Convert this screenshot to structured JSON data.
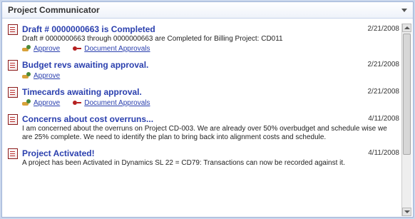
{
  "window": {
    "title": "Project Communicator"
  },
  "items": [
    {
      "title": "Draft # 0000000663 is Completed",
      "date": "2/21/2008",
      "description": "Draft # 0000000663 through 0000000663 are Completed for Billing Project: CD011",
      "actions": [
        "Approve",
        "Document Approvals"
      ]
    },
    {
      "title": "Budget revs awaiting approval.",
      "date": "2/21/2008",
      "description": "",
      "actions": [
        "Approve"
      ]
    },
    {
      "title": "Timecards awaiting approval.",
      "date": "2/21/2008",
      "description": "",
      "actions": [
        "Approve",
        "Document Approvals"
      ]
    },
    {
      "title": "Concerns about cost overruns...",
      "date": "4/11/2008",
      "description": "I am concerned about the overruns on Project CD-003. We are already over 50% overbudget and schedule wise we are 25% complete. We need to identify the plan to bring back into alignment costs and schedule.",
      "actions": []
    },
    {
      "title": "Project Activated!",
      "date": "4/11/2008",
      "description": "A project has been Activated in Dynamics SL 22 = CD79: Transactions can now be recorded against it.",
      "actions": []
    }
  ],
  "colors": {
    "link": "#2a3fae",
    "icon_red": "#8b1a1a",
    "border": "#9fb3d6"
  },
  "icons": {
    "item": "document-icon",
    "approve": "approve-icon",
    "document_approvals": "document-approvals-icon",
    "dropdown": "chevron-down-icon"
  }
}
